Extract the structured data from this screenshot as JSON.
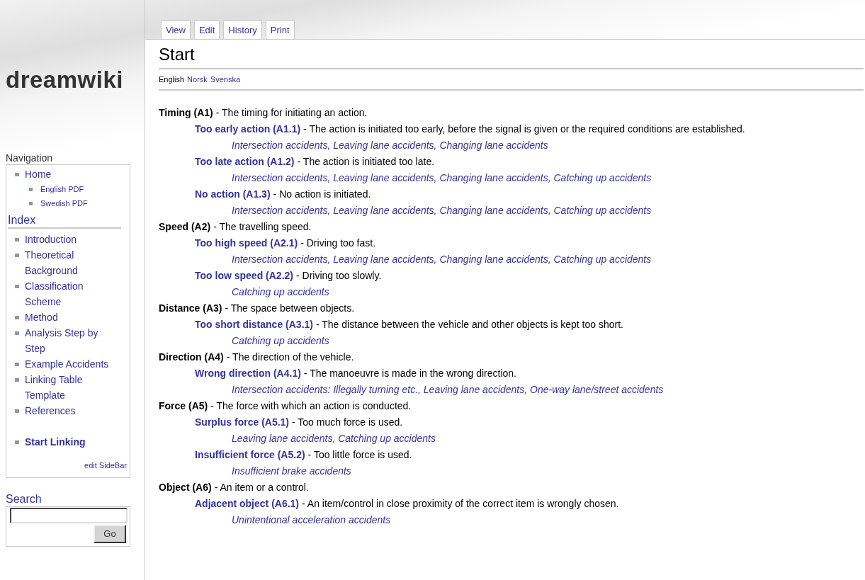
{
  "logo": "dreamwiki",
  "tabs": [
    "View",
    "Edit",
    "History",
    "Print"
  ],
  "page": {
    "title": "Start",
    "languages": [
      {
        "label": "English",
        "current": true
      },
      {
        "label": "Norsk",
        "current": false
      },
      {
        "label": "Svenska",
        "current": false
      }
    ]
  },
  "sidebar": {
    "navigation": {
      "heading": "Navigation",
      "items": [
        {
          "label": "Home",
          "children": [
            {
              "label": "English PDF"
            },
            {
              "label": "Swedish PDF"
            }
          ]
        }
      ]
    },
    "index": {
      "heading": "Index",
      "items": [
        {
          "label": "Introduction",
          "bold": false
        },
        {
          "label": "Theoretical Background",
          "bold": false
        },
        {
          "label": "Classification Scheme",
          "bold": false
        },
        {
          "label": "Method",
          "bold": false
        },
        {
          "label": "Analysis Step by Step",
          "bold": false
        },
        {
          "label": "Example Accidents",
          "bold": false
        },
        {
          "label": "Linking Table Template",
          "bold": false
        },
        {
          "label": "References",
          "bold": false
        },
        {
          "label": "Start Linking",
          "bold": true
        }
      ]
    },
    "edit_link": "edit SideBar",
    "search": {
      "heading": "Search",
      "button": "Go"
    }
  },
  "categories": [
    {
      "name": "Timing (A1)",
      "description": "- The timing for initiating an action.",
      "items": [
        {
          "name": "Too early action (A1.1)",
          "description": "- The action is initiated too early, before the signal is given or the required conditions are established.",
          "accidents": "Intersection accidents, Leaving lane accidents, Changing lane accidents"
        },
        {
          "name": "Too late action (A1.2)",
          "description": "- The action is initiated too late.",
          "accidents": "Intersection accidents, Leaving lane accidents, Changing lane accidents, Catching up accidents"
        },
        {
          "name": "No action (A1.3)",
          "description": "- No action is initiated.",
          "accidents": "Intersection accidents, Leaving lane accidents, Changing lane accidents, Catching up accidents"
        }
      ]
    },
    {
      "name": "Speed (A2)",
      "description": "- The travelling speed.",
      "items": [
        {
          "name": "Too high speed (A2.1)",
          "description": "- Driving too fast.",
          "accidents": "Intersection accidents, Leaving lane accidents, Changing lane accidents, Catching up accidents"
        },
        {
          "name": "Too low speed (A2.2)",
          "description": "- Driving too slowly.",
          "accidents": "Catching up accidents"
        }
      ]
    },
    {
      "name": "Distance (A3)",
      "description": "- The space between objects.",
      "items": [
        {
          "name": "Too short distance (A3.1)",
          "description": "- The distance between the vehicle and other objects is kept too short.",
          "accidents": "Catching up accidents"
        }
      ]
    },
    {
      "name": "Direction (A4)",
      "description": "- The direction of the vehicle.",
      "items": [
        {
          "name": "Wrong direction (A4.1)",
          "description": "- The manoeuvre is made in the wrong direction.",
          "accidents": "Intersection accidents: Illegally turning etc., Leaving lane accidents, One-way lane/street accidents"
        }
      ]
    },
    {
      "name": "Force (A5)",
      "description": "- The force with which an action is conducted.",
      "items": [
        {
          "name": "Surplus force (A5.1)",
          "description": "- Too much force is used.",
          "accidents": "Leaving lane accidents, Catching up accidents"
        },
        {
          "name": "Insufficient force (A5.2)",
          "description": "- Too little force is used.",
          "accidents": "Insufficient brake accidents"
        }
      ]
    },
    {
      "name": "Object (A6)",
      "description": "- An item or a control.",
      "items": [
        {
          "name": "Adjacent object (A6.1)",
          "description": "- An item/control in close proximity of the correct item is wrongly chosen.",
          "accidents": "Unintentional acceleration accidents"
        }
      ]
    }
  ]
}
